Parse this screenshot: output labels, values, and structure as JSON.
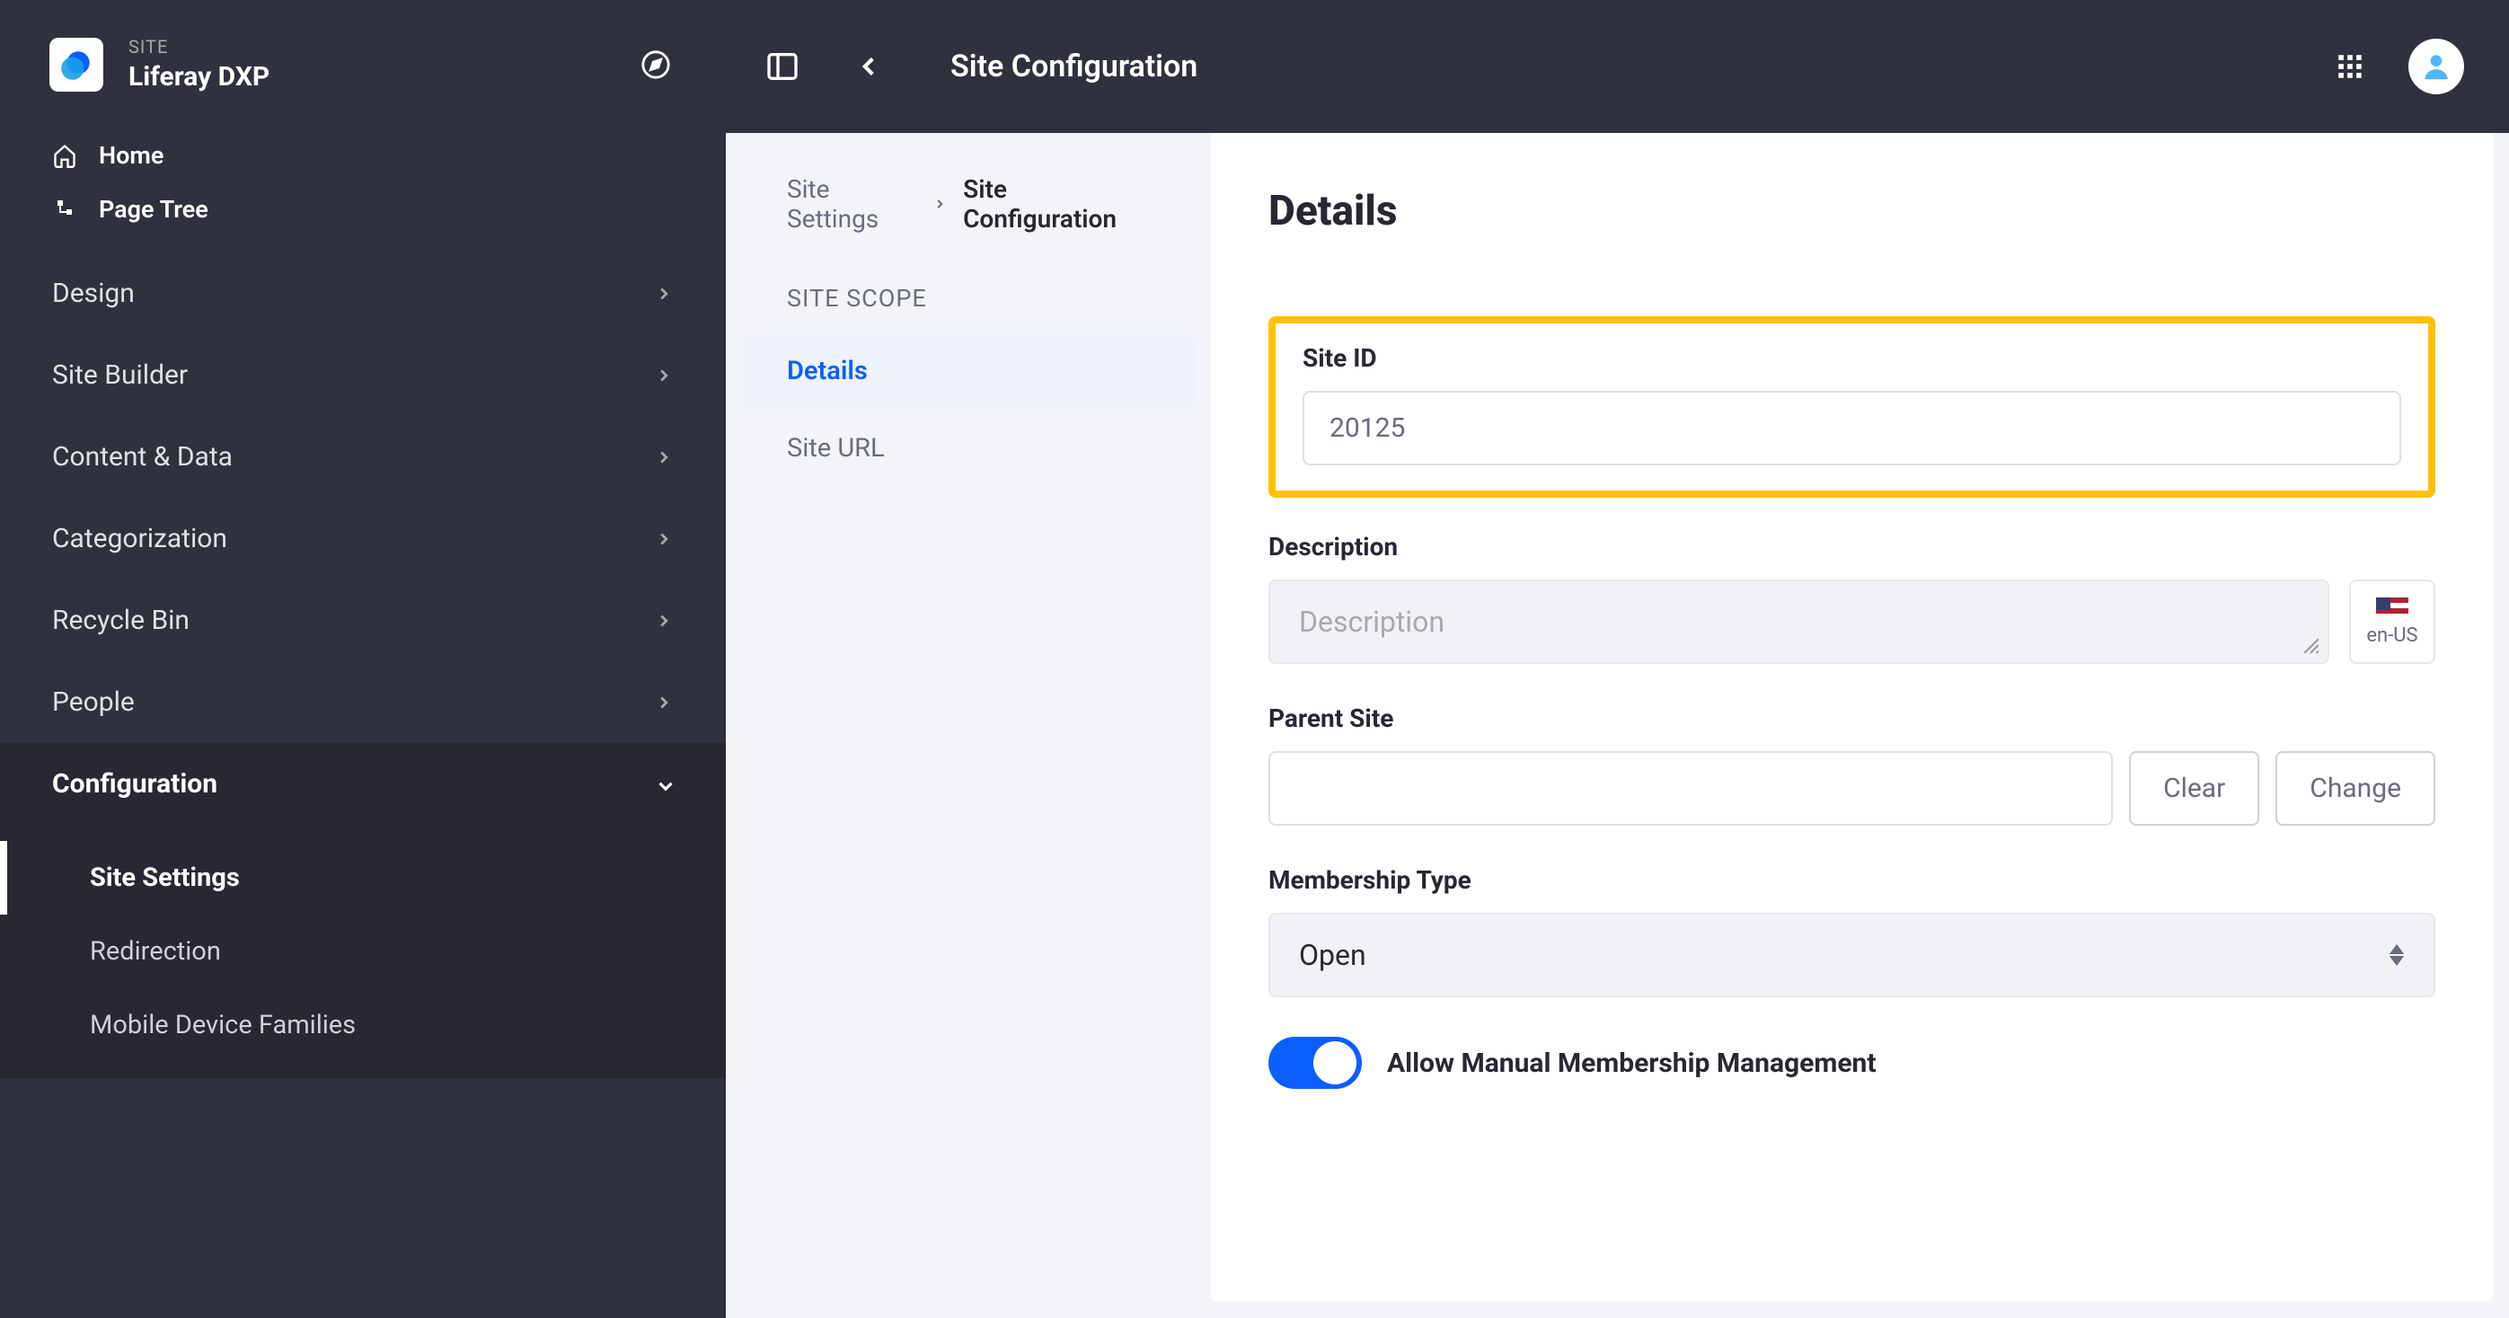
{
  "site": {
    "kicker": "SITE",
    "name": "Liferay DXP"
  },
  "nav": {
    "home": "Home",
    "pageTree": "Page Tree",
    "sections": {
      "design": "Design",
      "siteBuilder": "Site Builder",
      "contentData": "Content & Data",
      "categorization": "Categorization",
      "recycleBin": "Recycle Bin",
      "people": "People",
      "configuration": "Configuration"
    },
    "configSub": {
      "siteSettings": "Site Settings",
      "redirection": "Redirection",
      "mobileDeviceFamilies": "Mobile Device Families"
    }
  },
  "topbar": {
    "title": "Site Configuration"
  },
  "breadcrumb": {
    "parent": "Site Settings",
    "current": "Site Configuration"
  },
  "scope": {
    "label": "SITE SCOPE",
    "details": "Details",
    "siteUrl": "Site URL"
  },
  "form": {
    "heading": "Details",
    "siteId": {
      "label": "Site ID",
      "value": "20125"
    },
    "description": {
      "label": "Description",
      "placeholder": "Description",
      "locale": "en-US"
    },
    "parentSite": {
      "label": "Parent Site",
      "clear": "Clear",
      "change": "Change"
    },
    "membershipType": {
      "label": "Membership Type",
      "value": "Open"
    },
    "allowManual": {
      "label": "Allow Manual Membership Management",
      "on": true
    }
  }
}
